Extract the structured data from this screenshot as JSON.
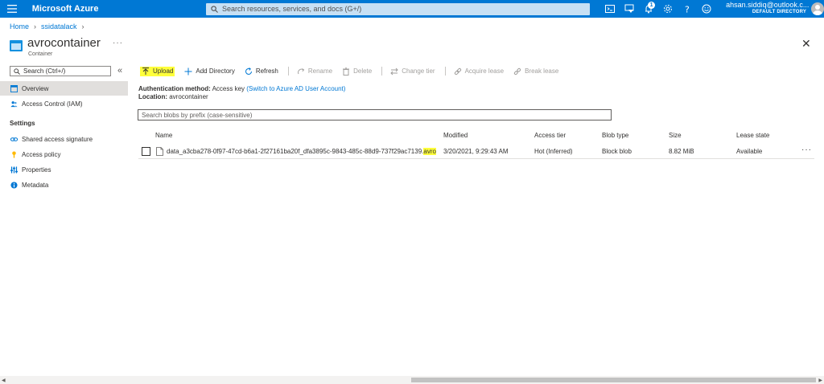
{
  "topbar": {
    "brand": "Microsoft Azure",
    "search_placeholder": "Search resources, services, and docs (G+/)",
    "notification_count": "1",
    "account_email": "ahsan.siddiq@outlook.c...",
    "account_directory": "DEFAULT DIRECTORY",
    "accent_color": "#0078d4"
  },
  "breadcrumb": {
    "home": "Home",
    "account": "ssidatalack"
  },
  "header": {
    "title": "avrocontainer",
    "subtitle": "Container"
  },
  "sidebar": {
    "search_placeholder": "Search (Ctrl+/)",
    "items": [
      {
        "label": "Overview",
        "icon": "overview-icon"
      },
      {
        "label": "Access Control (IAM)",
        "icon": "people-icon"
      }
    ],
    "section_settings": "Settings",
    "settings_items": [
      {
        "label": "Shared access signature",
        "icon": "link-icon"
      },
      {
        "label": "Access policy",
        "icon": "key-icon"
      },
      {
        "label": "Properties",
        "icon": "properties-icon"
      },
      {
        "label": "Metadata",
        "icon": "info-icon"
      }
    ]
  },
  "toolbar": {
    "upload": "Upload",
    "add_directory": "Add Directory",
    "refresh": "Refresh",
    "rename": "Rename",
    "delete": "Delete",
    "change_tier": "Change tier",
    "acquire_lease": "Acquire lease",
    "break_lease": "Break lease"
  },
  "auth": {
    "method_label": "Authentication method:",
    "method_value": "Access key",
    "switch_link": "(Switch to Azure AD User Account)",
    "location_label": "Location:",
    "location_value": "avrocontainer"
  },
  "blob_search_placeholder": "Search blobs by prefix (case-sensitive)",
  "table": {
    "columns": [
      "Name",
      "Modified",
      "Access tier",
      "Blob type",
      "Size",
      "Lease state"
    ],
    "rows": [
      {
        "name_base": "data_a3cba278-0f97-47cd-b6a1-2f27161ba20f_dfa3895c-9843-485c-88d9-737f29ac7139.",
        "name_ext": "avro",
        "modified": "3/20/2021, 9:29:43 AM",
        "access_tier": "Hot (Inferred)",
        "blob_type": "Block blob",
        "size": "8.82 MiB",
        "lease_state": "Available"
      }
    ]
  }
}
